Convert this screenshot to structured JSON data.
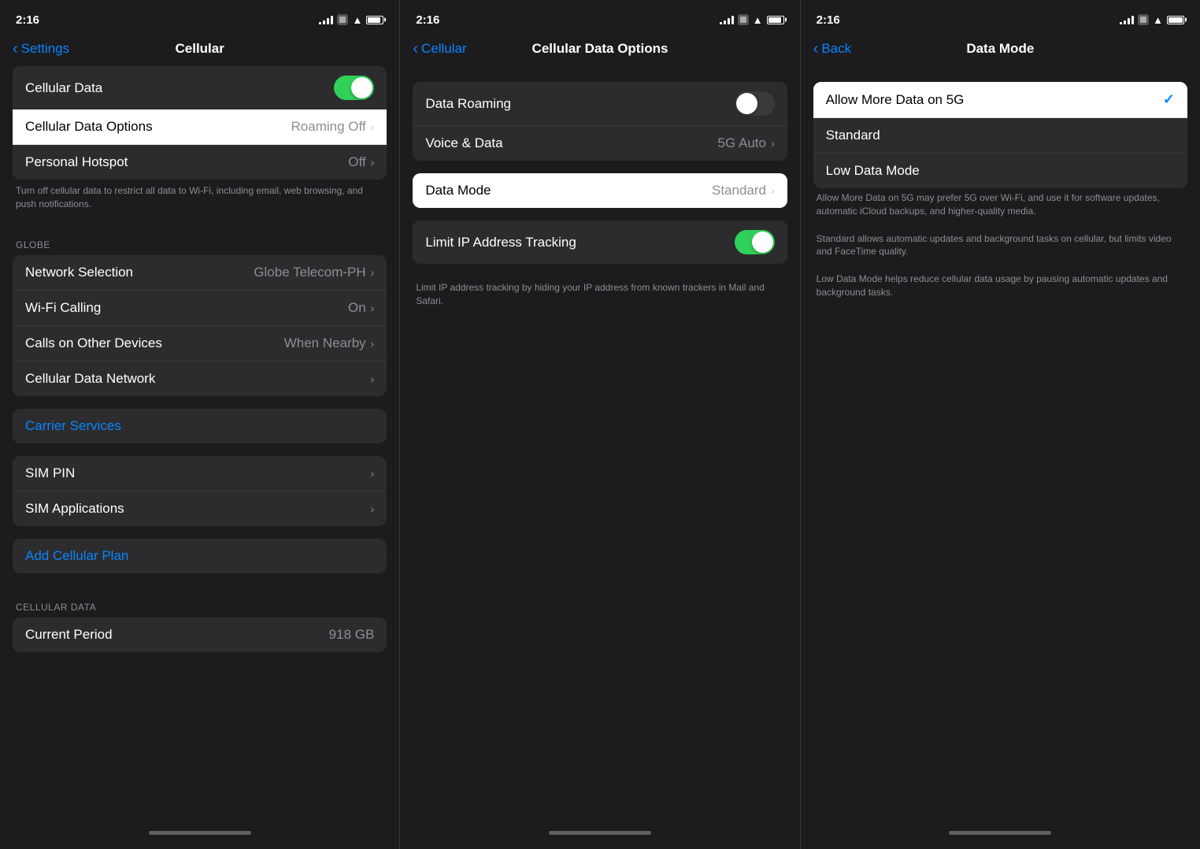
{
  "panel1": {
    "statusBar": {
      "time": "2:16",
      "badge": true
    },
    "navBack": "Settings",
    "navTitle": "Cellular",
    "sections": [
      {
        "type": "toggleItem",
        "label": "Cellular Data",
        "toggled": true
      },
      {
        "type": "navItem",
        "label": "Cellular Data Options",
        "value": "Roaming Off",
        "highlighted": true
      },
      {
        "type": "navItem",
        "label": "Personal Hotspot",
        "value": "Off"
      }
    ],
    "desc": "Turn off cellular data to restrict all data to Wi-Fi, including email, web browsing, and push notifications.",
    "globeLabel": "GLOBE",
    "globeItems": [
      {
        "label": "Network Selection",
        "value": "Globe Telecom-PH"
      },
      {
        "label": "Wi-Fi Calling",
        "value": "On"
      },
      {
        "label": "Calls on Other Devices",
        "value": "When Nearby"
      },
      {
        "label": "Cellular Data Network",
        "value": ""
      }
    ],
    "carrierServices": "Carrier Services",
    "simItems": [
      {
        "label": "SIM PIN",
        "value": ""
      },
      {
        "label": "SIM Applications",
        "value": ""
      }
    ],
    "addPlan": "Add Cellular Plan",
    "cellularDataLabel": "CELLULAR DATA",
    "currentPeriod": {
      "label": "Current Period",
      "value": "918 GB"
    }
  },
  "panel2": {
    "statusBar": {
      "time": "2:16",
      "badge": true
    },
    "navBack": "Cellular",
    "navTitle": "Cellular Data Options",
    "items": [
      {
        "label": "Data Roaming",
        "type": "toggle",
        "toggled": false
      },
      {
        "label": "Voice & Data",
        "type": "nav",
        "value": "5G Auto"
      },
      {
        "label": "Data Mode",
        "type": "nav",
        "value": "Standard",
        "highlighted": true
      }
    ],
    "limitLabel": "Limit IP Address Tracking",
    "limitToggled": true,
    "limitDesc": "Limit IP address tracking by hiding your IP address from known trackers in Mail and Safari."
  },
  "panel3": {
    "statusBar": {
      "time": "2:16",
      "badge": true
    },
    "navBack": "Back",
    "navTitle": "Data Mode",
    "options": [
      {
        "label": "Allow More Data on 5G",
        "selected": true,
        "highlighted": true
      },
      {
        "label": "Standard",
        "selected": false
      },
      {
        "label": "Low Data Mode",
        "selected": false
      }
    ],
    "desc1": "Allow More Data on 5G may prefer 5G over Wi-Fi, and use it for software updates, automatic iCloud backups, and higher-quality media.",
    "desc2": "Standard allows automatic updates and background tasks on cellular, but limits video and FaceTime quality.",
    "desc3": "Low Data Mode helps reduce cellular data usage by pausing automatic updates and background tasks."
  }
}
